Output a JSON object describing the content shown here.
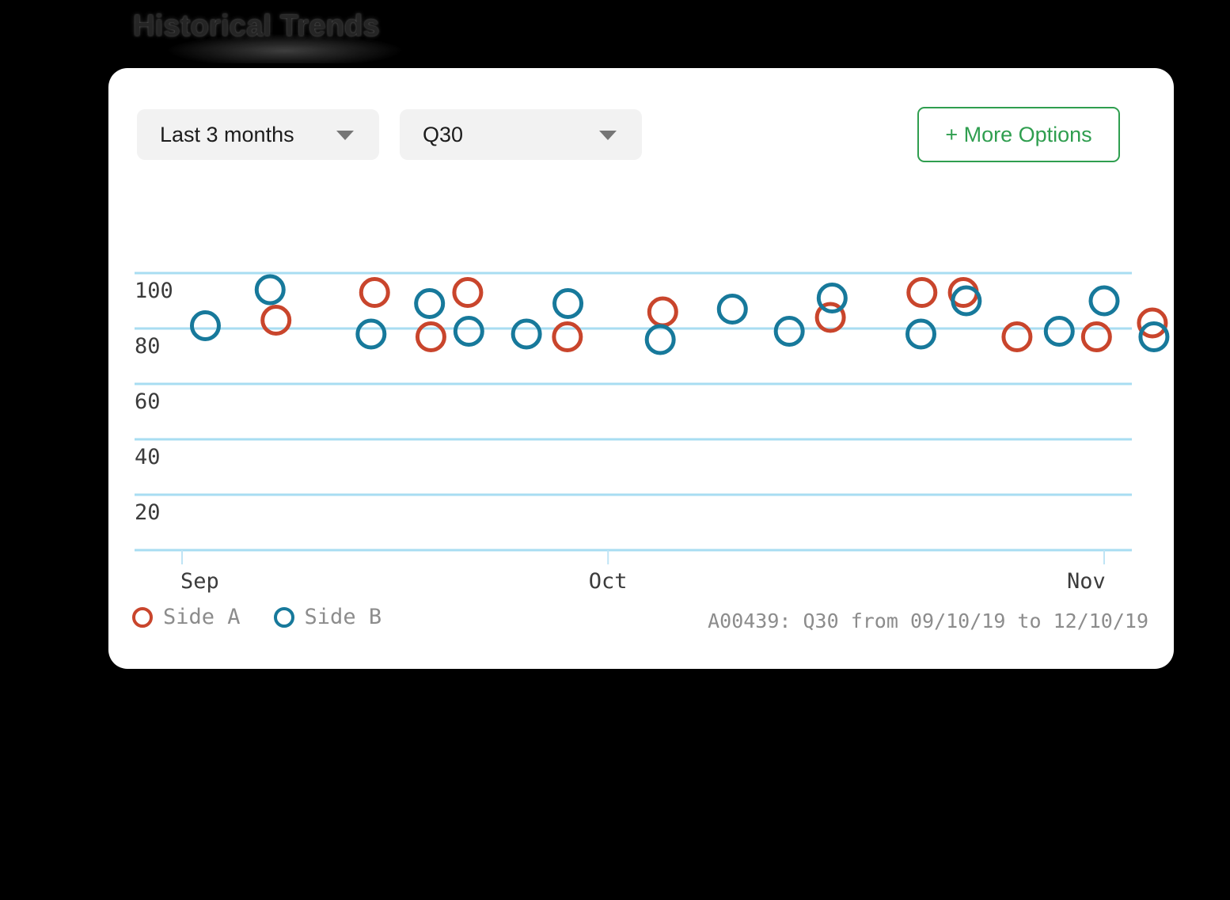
{
  "page": {
    "title": "Historical Trends",
    "background_color": "#000000",
    "card_background": "#ffffff"
  },
  "toolbar": {
    "range_dropdown": {
      "value": "Last 3 months",
      "icon": "chevron-down-icon"
    },
    "metric_dropdown": {
      "value": "Q30",
      "icon": "chevron-down-icon"
    },
    "more_options_label": "+ More Options",
    "more_options_color": "#2f9e4f"
  },
  "footer": {
    "note": "A00439: Q30 from 09/10/19 to 12/10/19"
  },
  "chart_data": {
    "type": "scatter",
    "title": "Historical Trends",
    "xlabel": "",
    "ylabel": "",
    "ylim": [
      0,
      110
    ],
    "yticks": [
      20,
      40,
      60,
      80,
      100
    ],
    "ytick_labels": [
      "20",
      "40",
      "60",
      "80",
      "100"
    ],
    "xtick_labels": [
      "Sep",
      "Oct",
      "Nov"
    ],
    "xtick_positions": [
      0.0,
      0.462,
      1.0
    ],
    "grid": true,
    "grid_color": "#a8ddf2",
    "legend_position": "bottom-left",
    "marker": "open-circle",
    "series": [
      {
        "name": "Side A",
        "color": "#c9452c",
        "points": [
          {
            "x": 0.1019,
            "y": 83
          },
          {
            "x": 0.2088,
            "y": 93
          },
          {
            "x": 0.2699,
            "y": 77
          },
          {
            "x": 0.3098,
            "y": 93
          },
          {
            "x": 0.4179,
            "y": 77
          },
          {
            "x": 0.5213,
            "y": 86
          },
          {
            "x": 0.7031,
            "y": 84
          },
          {
            "x": 0.8024,
            "y": 93
          },
          {
            "x": 0.8473,
            "y": 93
          },
          {
            "x": 0.9055,
            "y": 77
          },
          {
            "x": 0.9917,
            "y": 77
          },
          {
            "x": 1.0523,
            "y": 82
          }
        ]
      },
      {
        "name": "Side B",
        "color": "#17799b",
        "points": [
          {
            "x": 0.0253,
            "y": 81
          },
          {
            "x": 0.0955,
            "y": 94
          },
          {
            "x": 0.205,
            "y": 78
          },
          {
            "x": 0.2684,
            "y": 89
          },
          {
            "x": 0.311,
            "y": 79
          },
          {
            "x": 0.3735,
            "y": 78
          },
          {
            "x": 0.4185,
            "y": 89
          },
          {
            "x": 0.5186,
            "y": 76
          },
          {
            "x": 0.5968,
            "y": 87
          },
          {
            "x": 0.6585,
            "y": 79
          },
          {
            "x": 0.705,
            "y": 91
          },
          {
            "x": 0.8013,
            "y": 78
          },
          {
            "x": 0.8505,
            "y": 90
          },
          {
            "x": 0.9513,
            "y": 79
          },
          {
            "x": 1.0,
            "y": 90
          },
          {
            "x": 1.054,
            "y": 77
          }
        ]
      }
    ]
  },
  "legend": {
    "entries": [
      {
        "label": "Side A",
        "color": "#c9452c",
        "icon": "circle-outline-icon"
      },
      {
        "label": "Side B",
        "color": "#17799b",
        "icon": "circle-outline-icon"
      }
    ]
  }
}
